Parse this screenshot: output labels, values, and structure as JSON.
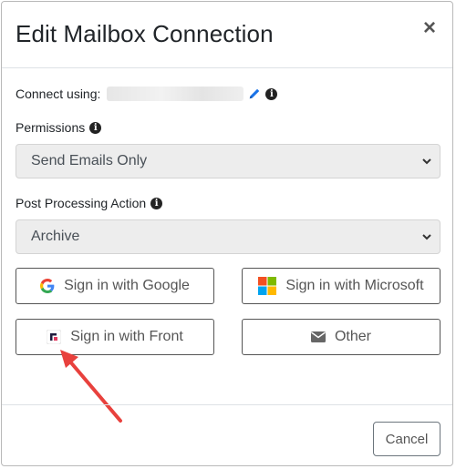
{
  "dialog": {
    "title": "Edit Mailbox Connection",
    "close_symbol": "×"
  },
  "connect": {
    "label": "Connect using:",
    "edit_icon": "pencil-icon",
    "info_icon": "info-icon"
  },
  "permissions": {
    "label": "Permissions",
    "selected": "Send Emails Only"
  },
  "post_processing": {
    "label": "Post Processing Action",
    "selected": "Archive"
  },
  "signin_buttons": {
    "google": "Sign in with Google",
    "microsoft": "Sign in with Microsoft",
    "front": "Sign in with Front",
    "other": "Other"
  },
  "footer": {
    "cancel_label": "Cancel"
  },
  "colors": {
    "annotation_arrow": "#e8413d",
    "select_bg": "#ededed",
    "pencil_blue": "#1a73e8"
  }
}
